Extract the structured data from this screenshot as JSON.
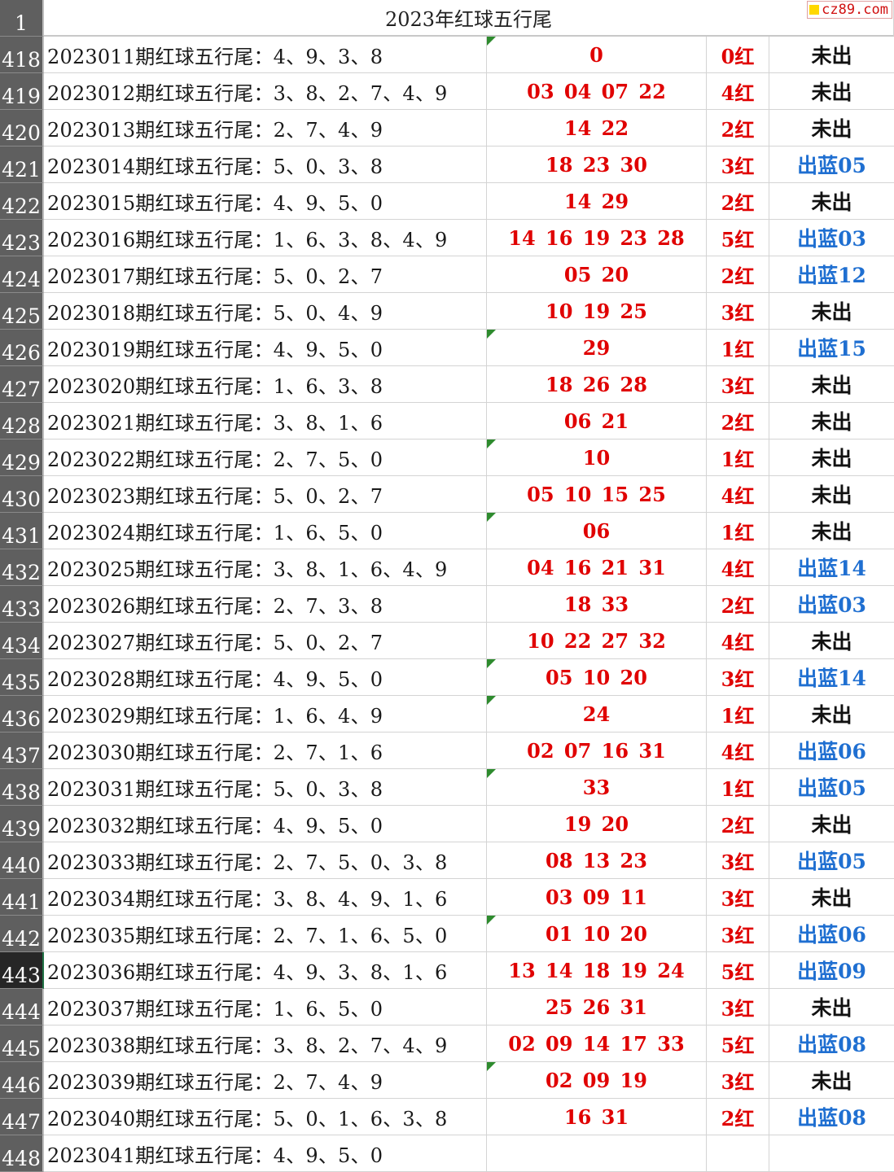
{
  "sheet": {
    "title": "2023年红球五行尾",
    "header_row_number": "1",
    "watermark": "cz89.com"
  },
  "rows": [
    {
      "n": "418",
      "desc": "2023011期红球五行尾：4、9、3、8",
      "nums": "0",
      "cnt": "0红",
      "res": "未出",
      "blue": false,
      "flag": true
    },
    {
      "n": "419",
      "desc": "2023012期红球五行尾：3、8、2、7、4、9",
      "nums": "03 04 07 22",
      "cnt": "4红",
      "res": "未出",
      "blue": false,
      "flag": false
    },
    {
      "n": "420",
      "desc": "2023013期红球五行尾：2、7、4、9",
      "nums": "14 22",
      "cnt": "2红",
      "res": "未出",
      "blue": false,
      "flag": false
    },
    {
      "n": "421",
      "desc": "2023014期红球五行尾：5、0、3、8",
      "nums": "18 23 30",
      "cnt": "3红",
      "res": "出蓝05",
      "blue": true,
      "flag": false
    },
    {
      "n": "422",
      "desc": "2023015期红球五行尾：4、9、5、0",
      "nums": "14 29",
      "cnt": "2红",
      "res": "未出",
      "blue": false,
      "flag": false
    },
    {
      "n": "423",
      "desc": "2023016期红球五行尾：1、6、3、8、4、9",
      "nums": "14 16 19 23 28",
      "cnt": "5红",
      "res": "出蓝03",
      "blue": true,
      "flag": false
    },
    {
      "n": "424",
      "desc": "2023017期红球五行尾：5、0、2、7",
      "nums": "05 20",
      "cnt": "2红",
      "res": "出蓝12",
      "blue": true,
      "flag": false
    },
    {
      "n": "425",
      "desc": "2023018期红球五行尾：5、0、4、9",
      "nums": "10 19 25",
      "cnt": "3红",
      "res": "未出",
      "blue": false,
      "flag": false
    },
    {
      "n": "426",
      "desc": "2023019期红球五行尾：4、9、5、0",
      "nums": "29",
      "cnt": "1红",
      "res": "出蓝15",
      "blue": true,
      "flag": true
    },
    {
      "n": "427",
      "desc": "2023020期红球五行尾：1、6、3、8",
      "nums": "18 26 28",
      "cnt": "3红",
      "res": "未出",
      "blue": false,
      "flag": false
    },
    {
      "n": "428",
      "desc": "2023021期红球五行尾：3、8、1、6",
      "nums": "06 21",
      "cnt": "2红",
      "res": "未出",
      "blue": false,
      "flag": false
    },
    {
      "n": "429",
      "desc": "2023022期红球五行尾：2、7、5、0",
      "nums": "10",
      "cnt": "1红",
      "res": "未出",
      "blue": false,
      "flag": true
    },
    {
      "n": "430",
      "desc": "2023023期红球五行尾：5、0、2、7",
      "nums": "05 10 15 25",
      "cnt": "4红",
      "res": "未出",
      "blue": false,
      "flag": false
    },
    {
      "n": "431",
      "desc": "2023024期红球五行尾：1、6、5、0",
      "nums": "06",
      "cnt": "1红",
      "res": "未出",
      "blue": false,
      "flag": true
    },
    {
      "n": "432",
      "desc": "2023025期红球五行尾：3、8、1、6、4、9",
      "nums": "04 16 21 31",
      "cnt": "4红",
      "res": "出蓝14",
      "blue": true,
      "flag": false
    },
    {
      "n": "433",
      "desc": "2023026期红球五行尾：2、7、3、8",
      "nums": "18 33",
      "cnt": "2红",
      "res": "出蓝03",
      "blue": true,
      "flag": false
    },
    {
      "n": "434",
      "desc": "2023027期红球五行尾：5、0、2、7",
      "nums": "10 22 27 32",
      "cnt": "4红",
      "res": "未出",
      "blue": false,
      "flag": false
    },
    {
      "n": "435",
      "desc": "2023028期红球五行尾：4、9、5、0",
      "nums": "05 10 20",
      "cnt": "3红",
      "res": "出蓝14",
      "blue": true,
      "flag": true
    },
    {
      "n": "436",
      "desc": "2023029期红球五行尾：1、6、4、9",
      "nums": "24",
      "cnt": "1红",
      "res": "未出",
      "blue": false,
      "flag": true
    },
    {
      "n": "437",
      "desc": "2023030期红球五行尾：2、7、1、6",
      "nums": "02 07 16 31",
      "cnt": "4红",
      "res": "出蓝06",
      "blue": true,
      "flag": false
    },
    {
      "n": "438",
      "desc": "2023031期红球五行尾：5、0、3、8",
      "nums": "33",
      "cnt": "1红",
      "res": "出蓝05",
      "blue": true,
      "flag": true
    },
    {
      "n": "439",
      "desc": "2023032期红球五行尾：4、9、5、0",
      "nums": "19 20",
      "cnt": "2红",
      "res": "未出",
      "blue": false,
      "flag": false
    },
    {
      "n": "440",
      "desc": "2023033期红球五行尾：2、7、5、0、3、8",
      "nums": "08 13 23",
      "cnt": "3红",
      "res": "出蓝05",
      "blue": true,
      "flag": false
    },
    {
      "n": "441",
      "desc": "2023034期红球五行尾：3、8、4、9、1、6",
      "nums": "03 09 11",
      "cnt": "3红",
      "res": "未出",
      "blue": false,
      "flag": false
    },
    {
      "n": "442",
      "desc": "2023035期红球五行尾：2、7、1、6、5、0",
      "nums": "01 10 20",
      "cnt": "3红",
      "res": "出蓝06",
      "blue": true,
      "flag": true
    },
    {
      "n": "443",
      "desc": "2023036期红球五行尾：4、9、3、8、1、6",
      "nums": "13 14 18 19 24",
      "cnt": "5红",
      "res": "出蓝09",
      "blue": true,
      "flag": false,
      "active": true
    },
    {
      "n": "444",
      "desc": "2023037期红球五行尾：1、6、5、0",
      "nums": "25 26 31",
      "cnt": "3红",
      "res": "未出",
      "blue": false,
      "flag": false
    },
    {
      "n": "445",
      "desc": "2023038期红球五行尾：3、8、2、7、4、9",
      "nums": "02 09 14 17 33",
      "cnt": "5红",
      "res": "出蓝08",
      "blue": true,
      "flag": false
    },
    {
      "n": "446",
      "desc": "2023039期红球五行尾：2、7、4、9",
      "nums": "02 09 19",
      "cnt": "3红",
      "res": "未出",
      "blue": false,
      "flag": true
    },
    {
      "n": "447",
      "desc": "2023040期红球五行尾：5、0、1、6、3、8",
      "nums": "16 31",
      "cnt": "2红",
      "res": "出蓝08",
      "blue": true,
      "flag": false
    },
    {
      "n": "448",
      "desc": "2023041期红球五行尾：4、9、5、0",
      "nums": "",
      "cnt": "",
      "res": "",
      "blue": false,
      "flag": false
    }
  ]
}
